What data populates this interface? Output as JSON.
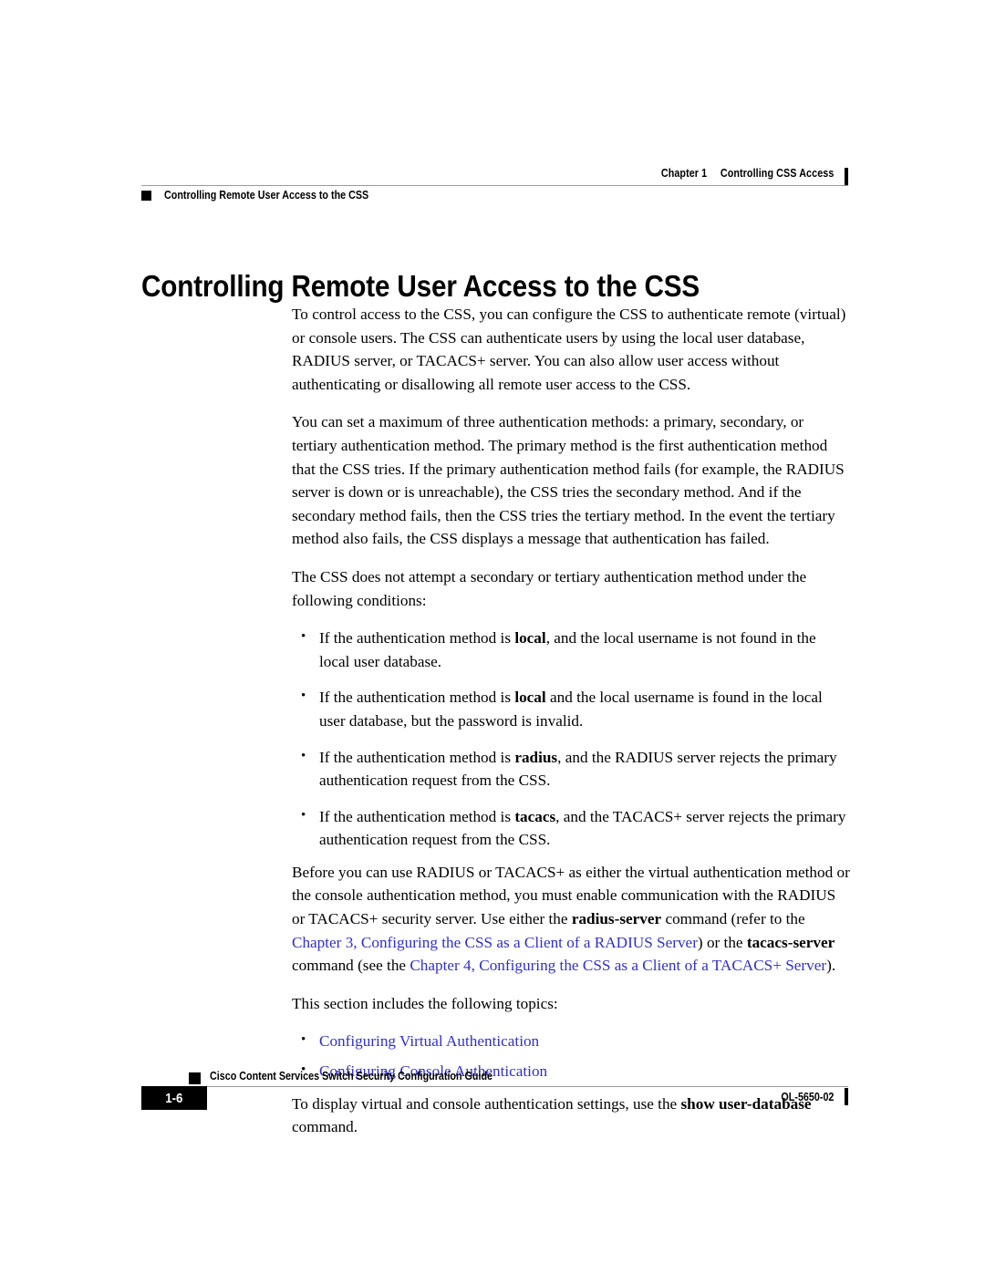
{
  "header": {
    "chapter_number": "Chapter 1",
    "chapter_title": "Controlling CSS Access",
    "section_title": "Controlling Remote User Access to the CSS"
  },
  "title": "Controlling Remote User Access to the CSS",
  "body": {
    "para_1": "To control access to the CSS, you can configure the CSS to authenticate remote (virtual) or console users. The CSS can authenticate users by using the local user database, RADIUS server, or TACACS+ server. You can also allow user access without authenticating or disallowing all remote user access to the CSS.",
    "para_2": "You can set a maximum of three authentication methods: a primary, secondary, or tertiary authentication method. The primary method is the first authentication method that the CSS tries. If the primary authentication method fails (for example, the RADIUS server is down or is unreachable), the CSS tries the secondary method. And if the secondary method fails, then the CSS tries the tertiary method. In the event the tertiary method also fails, the CSS displays a message that authentication has failed.",
    "para_3": "The CSS does not attempt a secondary or tertiary authentication method under the following conditions:",
    "conditions": [
      {
        "text_before": "If the authentication method is ",
        "keyword": "local",
        "text_after": ", and the local username is not found in the local user database."
      },
      {
        "text_before": "If the authentication method is ",
        "keyword": "local",
        "text_after": " and the local username is found in the local user database, but the password is invalid."
      },
      {
        "text_before": "If the authentication method is ",
        "keyword": "radius",
        "text_after": ", and the RADIUS server rejects the primary authentication request from the CSS."
      },
      {
        "text_before": "If the authentication method is ",
        "keyword": "tacacs",
        "text_after": ", and the TACACS+ server rejects the primary authentication request from the CSS."
      }
    ],
    "para_4": {
      "seg_1": "Before you can use RADIUS or TACACS+ as either the virtual authentication method or the console authentication method, you must enable communication with the RADIUS or TACACS+ security server. Use either the ",
      "cmd_1": "radius-server",
      "seg_2": " command (refer to the ",
      "link_1": "Chapter 3, Configuring the CSS as a Client of a RADIUS Server",
      "seg_3": ") or the ",
      "cmd_2": "tacacs-server",
      "seg_4": " command (see the ",
      "link_2": "Chapter 4, Configuring the CSS as a Client of a TACACS+ Server",
      "seg_5": ")."
    },
    "para_5": "This section includes the following topics:",
    "topics": [
      "Configuring Virtual Authentication",
      "Configuring Console Authentication"
    ],
    "para_6": {
      "seg_1": "To display virtual and console authentication settings, use the ",
      "cmd_1": "show user-database",
      "seg_2": " command."
    }
  },
  "footer": {
    "page_number": "1-6",
    "guide_title": "Cisco Content Services Switch Security Configuration Guide",
    "document_number": "OL-5650-02"
  },
  "colors": {
    "link": "#2f2fcf",
    "rule": "#9a9a9a",
    "text": "#000000"
  }
}
